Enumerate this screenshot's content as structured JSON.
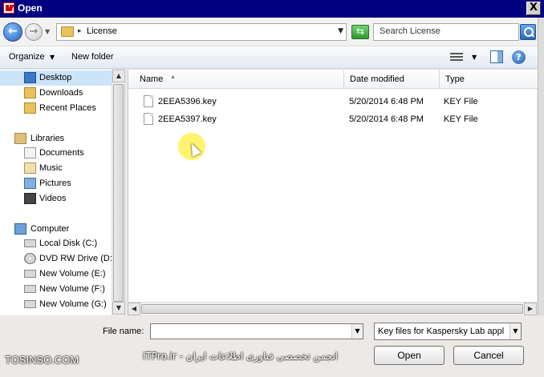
{
  "window": {
    "title": "Open",
    "close_label": "X"
  },
  "address": {
    "back_label": "←",
    "forward_label": "→",
    "path_separator": "▸",
    "path": "License",
    "search_placeholder": "Search License"
  },
  "toolbar": {
    "organize": "Organize",
    "new_folder": "New folder",
    "help": "?"
  },
  "nav": {
    "items": [
      {
        "label": "Desktop"
      },
      {
        "label": "Downloads"
      },
      {
        "label": "Recent Places"
      },
      {
        "label": "Libraries"
      },
      {
        "label": "Documents"
      },
      {
        "label": "Music"
      },
      {
        "label": "Pictures"
      },
      {
        "label": "Videos"
      },
      {
        "label": "Computer"
      },
      {
        "label": "Local Disk (C:)"
      },
      {
        "label": "DVD RW Drive (D:)"
      },
      {
        "label": "New Volume (E:)"
      },
      {
        "label": "New Volume (F:)"
      },
      {
        "label": "New Volume (G:)"
      }
    ]
  },
  "files": {
    "columns": {
      "name": "Name",
      "date": "Date modified",
      "type": "Type"
    },
    "rows": [
      {
        "name": "2EEA5396.key",
        "date": "5/20/2014 6:48 PM",
        "type": "KEY File"
      },
      {
        "name": "2EEA5397.key",
        "date": "5/20/2014 6:48 PM",
        "type": "KEY File"
      }
    ]
  },
  "bottom": {
    "file_name_label": "File name:",
    "file_name_value": "",
    "filter": "Key files for Kaspersky Lab appl",
    "open_label": "Open",
    "cancel_label": "Cancel"
  },
  "watermark": {
    "left": "TOSINSO.COM",
    "right": "ITPro.ir - انجمن تخصصی فناوری اطلاعات ایران"
  },
  "colors": {
    "titlebar": "#000080",
    "selection": "#cce4f7",
    "cursor_highlight": "#fff03c"
  }
}
